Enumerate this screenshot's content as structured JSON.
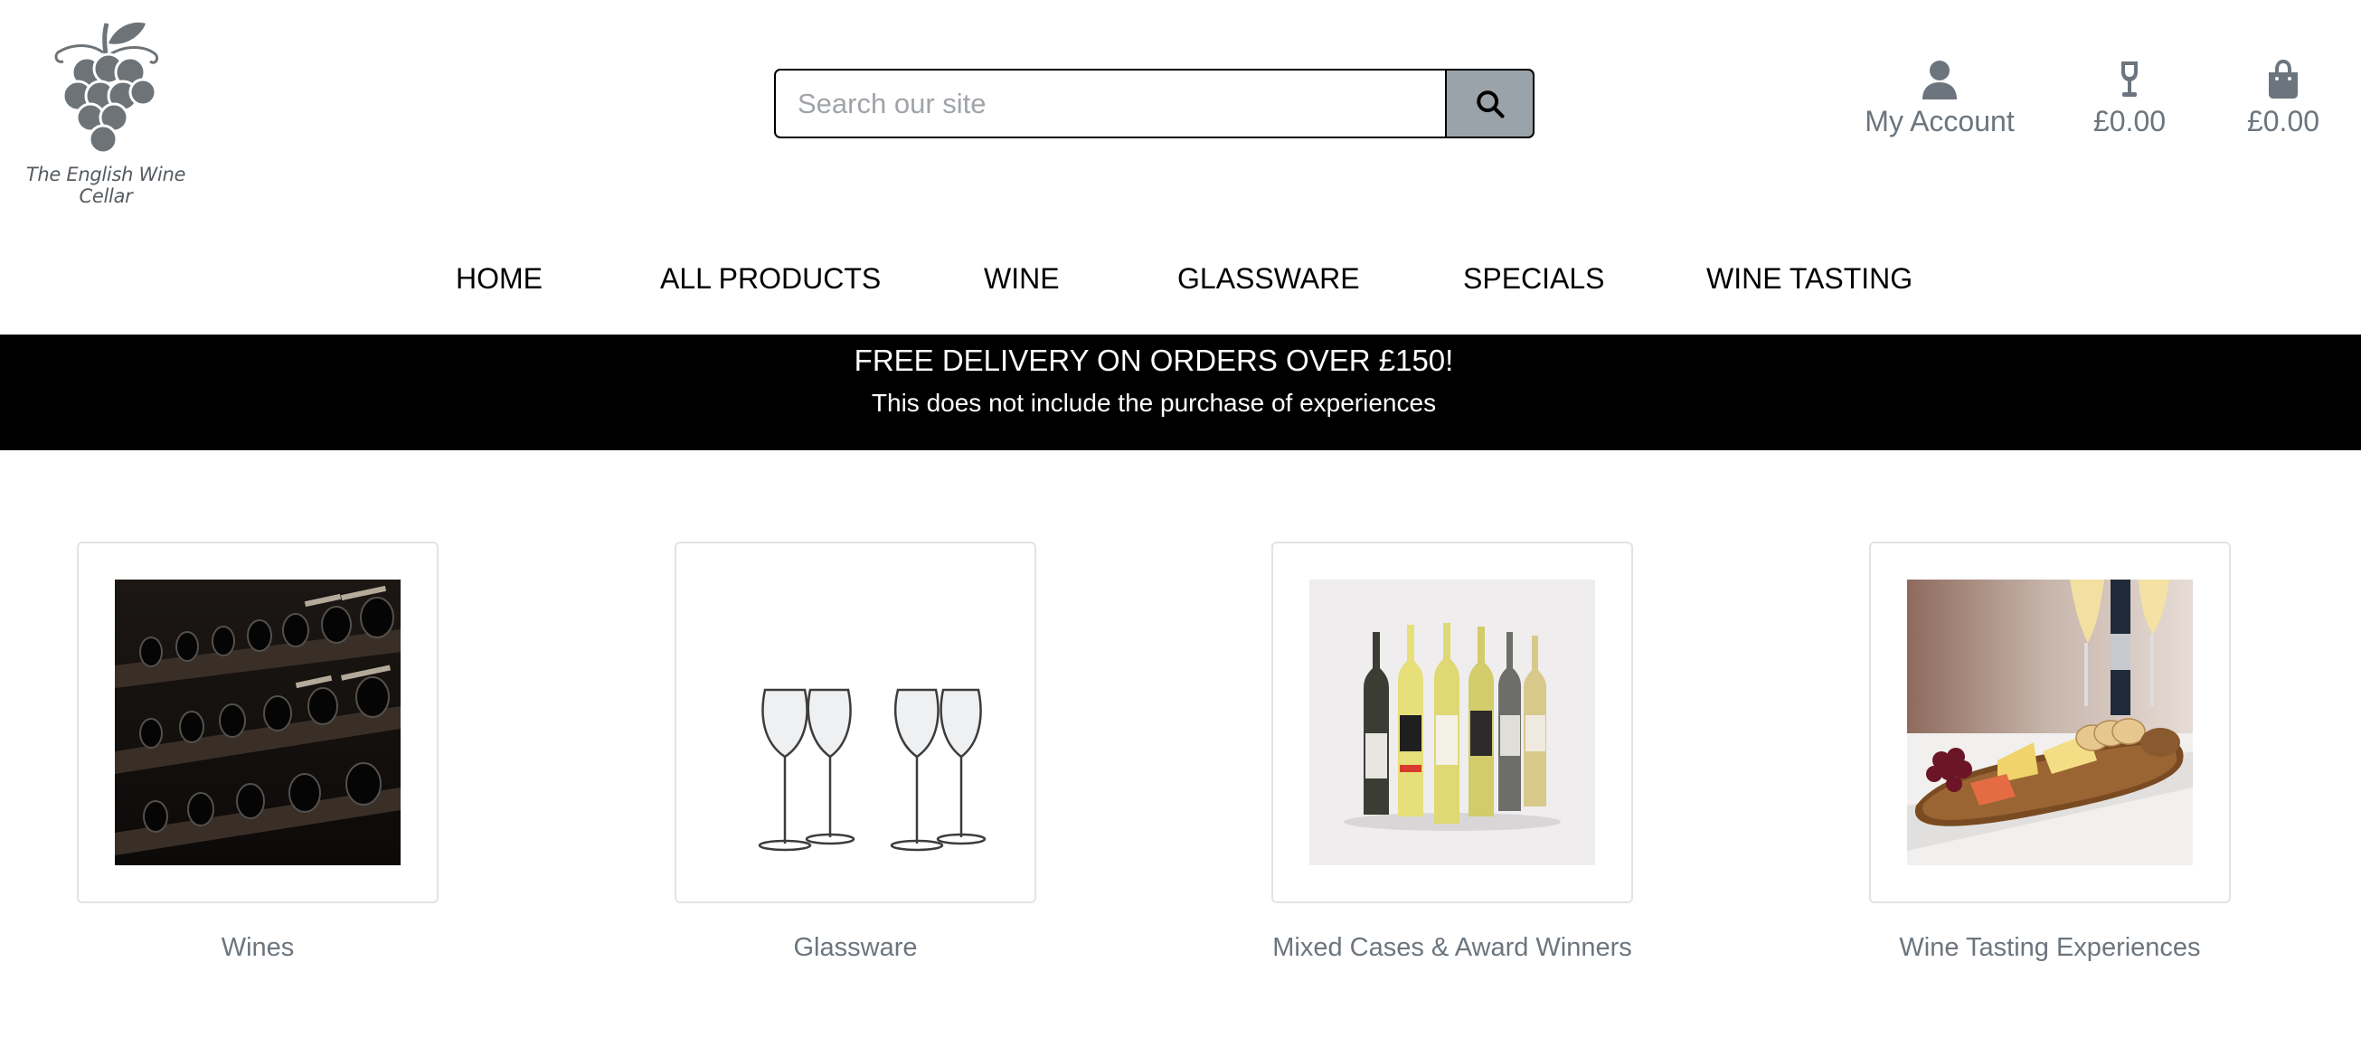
{
  "brand": {
    "name": "The English Wine Cellar",
    "icon": "grapes-logo-icon"
  },
  "search": {
    "placeholder": "Search our site",
    "value": "",
    "icon": "search-icon"
  },
  "header": {
    "account_label": "My Account",
    "wishlist_label": "£0.00",
    "bag_label": "£0.00"
  },
  "nav": {
    "items": [
      "HOME",
      "ALL PRODUCTS",
      "WINE",
      "GLASSWARE",
      "SPECIALS",
      "WINE TASTING"
    ]
  },
  "banner": {
    "title": "FREE DELIVERY ON ORDERS OVER £150!",
    "subtitle": "This does not include the purchase of experiences"
  },
  "categories": [
    {
      "label": "Wines",
      "image": "wine-rack-photo"
    },
    {
      "label": "Glassware",
      "image": "wine-glasses-photo"
    },
    {
      "label": "Mixed Cases & Award Winners",
      "image": "wine-bottles-photo"
    },
    {
      "label": "Wine Tasting Experiences",
      "image": "cheese-board-photo"
    }
  ],
  "colors": {
    "accent_grey": "#6c757d",
    "search_button": "#9aa3a9",
    "banner_bg": "#000000",
    "card_border": "#e3e3e3"
  }
}
